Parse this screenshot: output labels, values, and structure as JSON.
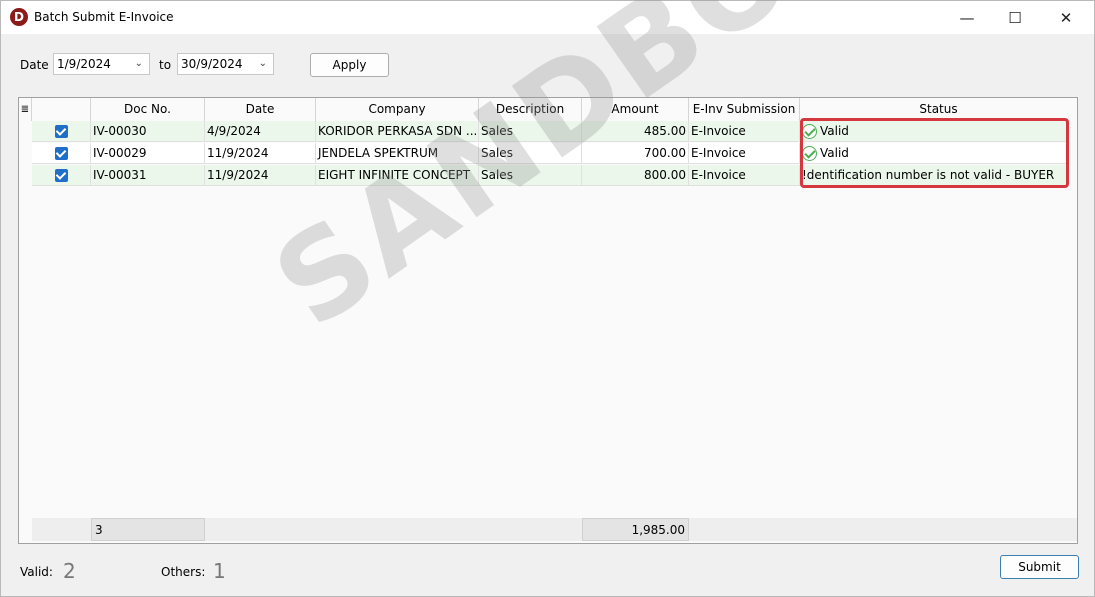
{
  "window": {
    "title": "Batch Submit E-Invoice",
    "icon_letter": "D",
    "minimize": "—",
    "maximize": "☐",
    "close": "✕"
  },
  "filter": {
    "date_label": "Date",
    "date_from": "1/9/2024",
    "to_label": "to",
    "date_to": "30/9/2024",
    "apply_label": "Apply"
  },
  "grid": {
    "menu_icon": "≣",
    "columns": [
      "",
      "Doc No.",
      "Date",
      "Company",
      "Description",
      "Amount",
      "E-Inv Submission",
      "Status"
    ],
    "rows": [
      {
        "doc": "IV-00030",
        "date": "4/9/2024",
        "company": "KORIDOR PERKASA SDN ...",
        "desc": "Sales",
        "amount": "485.00",
        "einv": "E-Invoice",
        "status": "Valid",
        "status_type": "valid"
      },
      {
        "doc": "IV-00029",
        "date": "11/9/2024",
        "company": "JENDELA SPEKTRUM",
        "desc": "Sales",
        "amount": "700.00",
        "einv": "E-Invoice",
        "status": "Valid",
        "status_type": "valid"
      },
      {
        "doc": "IV-00031",
        "date": "11/9/2024",
        "company": "EIGHT INFINITE CONCEPT",
        "desc": "Sales",
        "amount": "800.00",
        "einv": "E-Invoice",
        "status": "!dentification number is not valid - BUYER",
        "status_type": "error"
      }
    ],
    "footer_count": "3",
    "footer_total": "1,985.00"
  },
  "summary": {
    "valid_label": "Valid:",
    "valid_count": "2",
    "others_label": "Others:",
    "others_count": "1",
    "submit_label": "Submit"
  },
  "watermark": "SANDBOX",
  "colors": {
    "row_bg": "#eaf7ea",
    "highlight": "#d4383e",
    "check": "#1f6fc8",
    "valid_icon": "#4caf50"
  }
}
